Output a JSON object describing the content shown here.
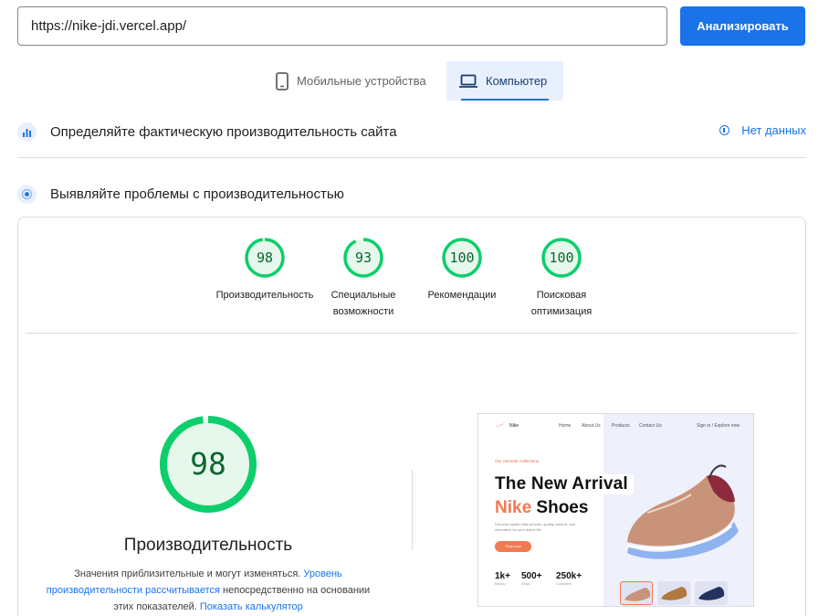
{
  "search": {
    "url": "https://nike-jdi.vercel.app/",
    "analyze_label": "Анализировать"
  },
  "tabs": [
    {
      "label": "Мобильные устройства",
      "icon": "phone-icon",
      "selected": false
    },
    {
      "label": "Компьютер",
      "icon": "laptop-icon",
      "selected": true
    }
  ],
  "field_section": {
    "title": "Определяйте фактическую производительность сайта",
    "status": "Нет данных",
    "icon": "field-data-icon"
  },
  "lab_section": {
    "title": "Выявляйте проблемы с производительностью",
    "icon": "lab-data-icon"
  },
  "colors": {
    "accent": "#1a73e8",
    "pass": "#0cce6b",
    "pass_text": "#0d652d",
    "pass_bg": "#e6f7ec"
  },
  "scores": [
    {
      "value": 98,
      "label": "Производительность"
    },
    {
      "value": 93,
      "label": "Специальные возможности"
    },
    {
      "value": 100,
      "label": "Рекомендации"
    },
    {
      "value": 100,
      "label": "Поисковая оптимизация"
    }
  ],
  "performance": {
    "score": 98,
    "title": "Производительность",
    "note_prefix": "Значения приблизительные и могут изменяться. ",
    "note_link1": "Уровень производительности рассчитывается",
    "note_middle": " непосредственно на основании этих показателей. ",
    "note_link2": "Показать калькулятор"
  },
  "screenshot": {
    "brand": "Nike",
    "nav": [
      "Home",
      "About Us",
      "Products",
      "Contact Us"
    ],
    "auth": "Sign in / Explore now",
    "tag": "Our Summer collections",
    "headline1": "The New Arrival",
    "headline2_accent": "Nike",
    "headline2_rest": " Shoes",
    "subtext": "Discover stylish Nike arrivals, quality comfort, and innovation for your active life.",
    "cta": "Shop now",
    "stats": [
      {
        "value": "1k+",
        "label": "Brands"
      },
      {
        "value": "500+",
        "label": "Shops"
      },
      {
        "value": "250k+",
        "label": "Customers"
      }
    ]
  }
}
